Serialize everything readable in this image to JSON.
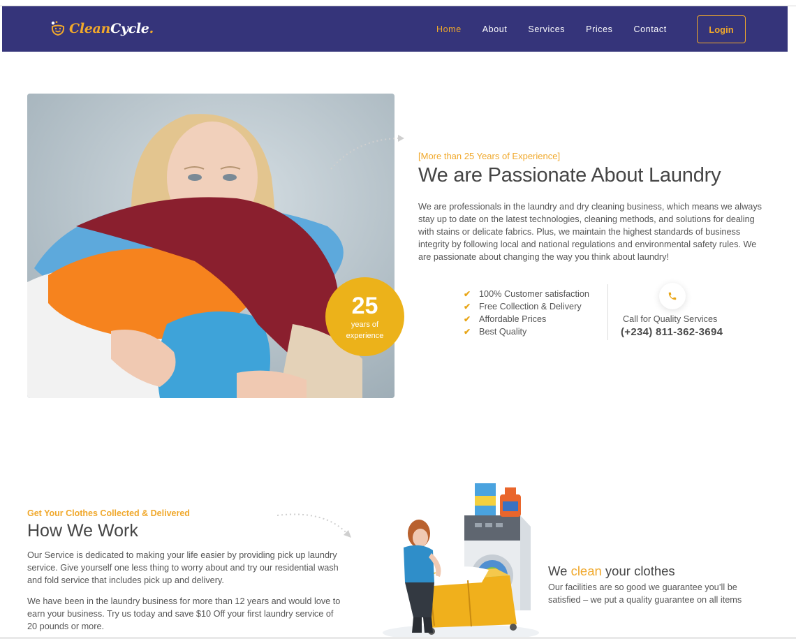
{
  "brand": {
    "name_part1": "Clean",
    "name_part2": "Cycle",
    "dot": ".",
    "accent_color": "#f0a82b",
    "nav_bg_color": "#35347a",
    "icon": "smiley-logo-icon"
  },
  "nav": {
    "items": [
      {
        "label": "Home",
        "active": true
      },
      {
        "label": "About",
        "active": false
      },
      {
        "label": "Services",
        "active": false
      },
      {
        "label": "Prices",
        "active": false
      },
      {
        "label": "Contact",
        "active": false
      }
    ],
    "login_label": "Login"
  },
  "about": {
    "badge_number": "25",
    "badge_label": "years of experience",
    "eyebrow": "[More than 25 Years of Experience]",
    "title": "We are Passionate About Laundry",
    "paragraph": "We are professionals in the laundry and dry cleaning business, which means we always stay up to date on the latest technologies, cleaning methods, and solutions for dealing with stains or delicate fabrics. Plus, we maintain the highest standards of business integrity by following local and national regulations and environmental safety rules. We are passionate about changing the way you think about laundry!",
    "features": [
      "100% Customer satisfaction",
      "Free Collection & Delivery",
      "Affordable Prices",
      "Best Quality"
    ],
    "call_label": "Call for Quality Services",
    "call_number": "(+234) 811-362-3694",
    "check_icon": "check-icon",
    "phone_icon": "phone-icon"
  },
  "how": {
    "eyebrow": "Get Your Clothes Collected & Delivered",
    "title": "How We Work",
    "paragraph1": "Our Service is dedicated to making your life easier by providing pick up laundry service. Give yourself one less thing to worry about and try our residential wash and fold service that includes pick up and delivery.",
    "paragraph2": "We have been in the laundry business for more than 12 years and would love to earn your business. Try us today and save $10 Off your first laundry service of 20 pounds or more.",
    "clean_title_before": "We ",
    "clean_title_highlight": "clean",
    "clean_title_after": " your clothes",
    "clean_desc": "Our facilities are so good we guarantee you’ll be satisfied – we put a quality guarantee on all items"
  }
}
